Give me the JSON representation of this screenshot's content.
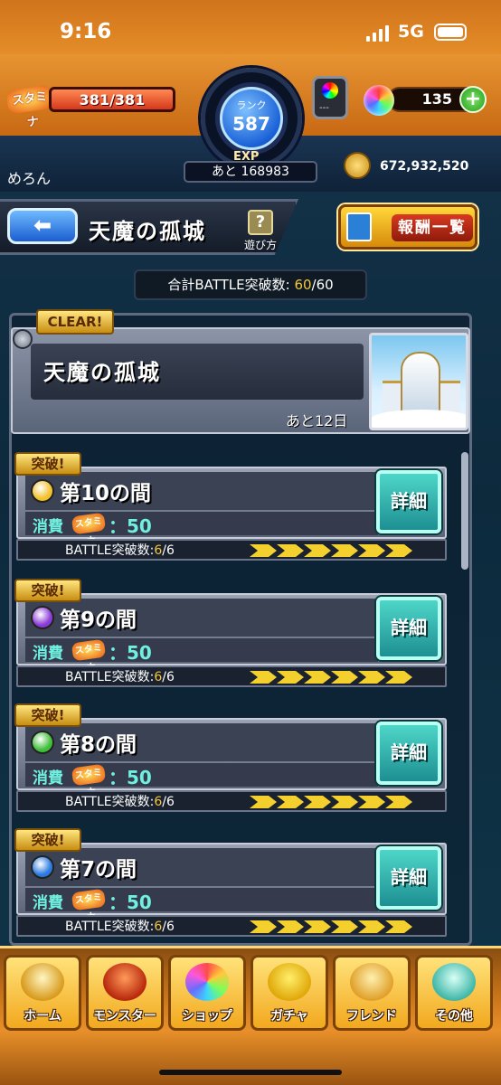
{
  "status": {
    "time": "9:16",
    "network": "5G"
  },
  "player": {
    "stamina_label": "スタミナ",
    "stamina": "381/381",
    "stamina_fraction": 1.0,
    "rank_label": "ランク",
    "rank": "587",
    "exp_label": "EXP",
    "exp_remaining": "あと 168983",
    "egg_label": "---",
    "orbs": "135",
    "orb_add": "+",
    "name": "めろん",
    "gold": "672,932,520"
  },
  "quest": {
    "back_icon": "arrow-left-icon",
    "title": "天魔の孤城",
    "help_icon": "?",
    "help_label": "遊び方",
    "reward_label": "報酬一覧",
    "battle_total_label": "合計BATTLE突破数:",
    "battle_total_done": "60",
    "battle_total_max": "/60"
  },
  "clear_card": {
    "badge": "CLEAR!",
    "name": "天魔の孤城",
    "remaining": "あと12日"
  },
  "stages": [
    {
      "badge": "突破!",
      "name": "第10の間",
      "element": "light",
      "color": "#f2c12e",
      "cost_label": "消費",
      "cost_icon": "スタミナ",
      "cost": "：50",
      "detail": "詳細",
      "progress_label": "BATTLE突破数:",
      "progress_done": "6",
      "progress_max": "/6"
    },
    {
      "badge": "突破!",
      "name": "第9の間",
      "element": "dark",
      "color": "#8a3ad8",
      "cost_label": "消費",
      "cost_icon": "スタミナ",
      "cost": "：50",
      "detail": "詳細",
      "progress_label": "BATTLE突破数:",
      "progress_done": "6",
      "progress_max": "/6"
    },
    {
      "badge": "突破!",
      "name": "第8の間",
      "element": "wood",
      "color": "#3fbf3a",
      "cost_label": "消費",
      "cost_icon": "スタミナ",
      "cost": "：50",
      "detail": "詳細",
      "progress_label": "BATTLE突破数:",
      "progress_done": "6",
      "progress_max": "/6"
    },
    {
      "badge": "突破!",
      "name": "第7の間",
      "element": "water",
      "color": "#2a7ae0",
      "cost_label": "消費",
      "cost_icon": "スタミナ",
      "cost": "：50",
      "detail": "詳細",
      "progress_label": "BATTLE突破数:",
      "progress_done": "6",
      "progress_max": "/6"
    }
  ],
  "nav": [
    {
      "label": "ホーム",
      "icon": "home-icon"
    },
    {
      "label": "モンスター",
      "icon": "monster-icon"
    },
    {
      "label": "ショップ",
      "icon": "orb-shop-icon"
    },
    {
      "label": "ガチャ",
      "icon": "gacha-egg-icon"
    },
    {
      "label": "フレンド",
      "icon": "friend-icon"
    },
    {
      "label": "その他",
      "icon": "other-icon"
    }
  ]
}
